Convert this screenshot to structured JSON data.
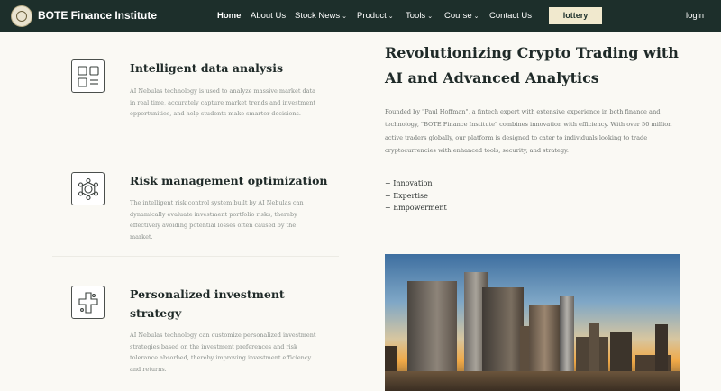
{
  "nav": {
    "brand": "BOTE Finance Institute",
    "items": [
      {
        "label": "Home",
        "active": true,
        "caret": false
      },
      {
        "label": "About Us",
        "caret": false
      },
      {
        "label": "Stock News",
        "caret": true
      },
      {
        "label": "Product",
        "caret": true
      },
      {
        "label": "Tools",
        "caret": true
      },
      {
        "label": "Course",
        "caret": true
      },
      {
        "label": "Contact Us",
        "caret": false
      }
    ],
    "lottery": "lottery",
    "login": "login",
    "caret_glyph": "⌄"
  },
  "features": [
    {
      "title": "Intelligent data analysis",
      "desc": "AI Nebulas technology is used to analyze massive market data in real time, accurately capture market trends and investment opportunities, and help students make smarter decisions.",
      "icon": "grid-chart-icon"
    },
    {
      "title": "Risk management optimization",
      "desc": "The intelligent risk control system built by AI Nebulas can dynamically evaluate investment portfolio risks, thereby effectively avoiding potential losses often caused by the market.",
      "icon": "network-hexagon-icon"
    },
    {
      "title": "Personalized investment strategy",
      "desc": "AI Nebulas technology can customize personalized investment strategies based on the investment preferences and risk tolerance absorbed, thereby improving investment efficiency and returns.",
      "icon": "puzzle-cross-icon"
    }
  ],
  "hero": {
    "title": "Revolutionizing Crypto Trading with AI and Advanced Analytics",
    "text": "Founded by \"Paul Hoffman\", a fintech expert with extensive experience in both finance and technology, \"BOTE Finance Institute\" combines innovation with efficiency. With over 50 million active traders globally, our platform is designed to cater to individuals looking to trade cryptocurrencies with enhanced tools, security, and strategy.",
    "bullets": [
      "+ Innovation",
      "+ Expertise",
      "+ Empowerment"
    ]
  },
  "colors": {
    "nav_bg": "#1d2f2b",
    "page_bg": "#faf9f4",
    "lottery_bg": "#f1e9ce"
  }
}
